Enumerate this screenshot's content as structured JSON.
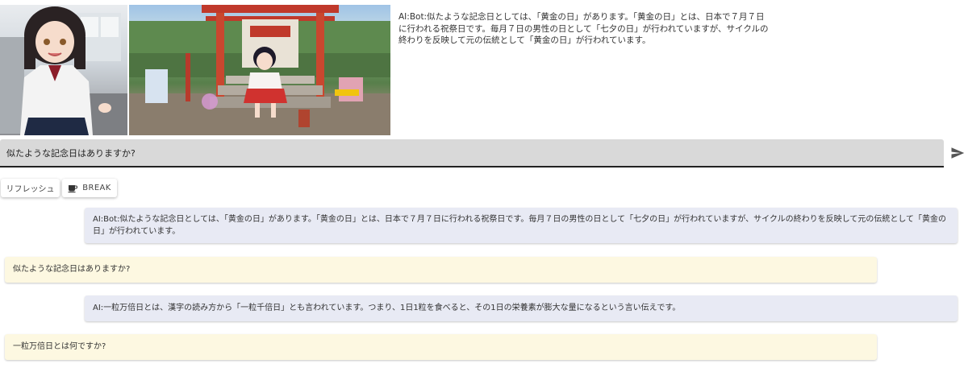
{
  "images": {
    "left": {
      "icon": "anime-girl-kitchen-image"
    },
    "right": {
      "icon": "shrine-torii-girl-image"
    }
  },
  "latest_response": "AI:Bot:似たような記念日としては、「黄金の日」があります。「黄金の日」とは、日本で７月７日に行われる祝祭日です。毎月７日の男性の日として「七夕の日」が行われていますが、サイクルの終わりを反映して元の伝統として「黄金の日」が行われています。",
  "input": {
    "value": "似たような記念日はありますか?",
    "send_icon": "send-icon"
  },
  "buttons": {
    "refresh_label": "リフレッシュ",
    "break_label": "BREAK",
    "break_icon": "coffee-cup-icon"
  },
  "messages": [
    {
      "role": "bot",
      "text": "AI:Bot:似たような記念日としては、「黄金の日」があります。「黄金の日」とは、日本で７月７日に行われる祝祭日です。毎月７日の男性の日として「七夕の日」が行われていますが、サイクルの終わりを反映して元の伝統として「黄金の日」が行われています。"
    },
    {
      "role": "user",
      "text": "似たような記念日はありますか?"
    },
    {
      "role": "bot",
      "text": "AI:一粒万倍日とは、漢字の読み方から「一粒千倍日」とも言われています。つまり、1日1粒を食べると、その1日の栄養素が膨大な量になるという言い伝えです。"
    },
    {
      "role": "user",
      "text": "一粒万倍日とは何ですか?"
    }
  ],
  "colors": {
    "bot_bubble": "#e8eaf4",
    "user_bubble": "#fdf8e1",
    "input_bg": "#d9d9d9"
  }
}
